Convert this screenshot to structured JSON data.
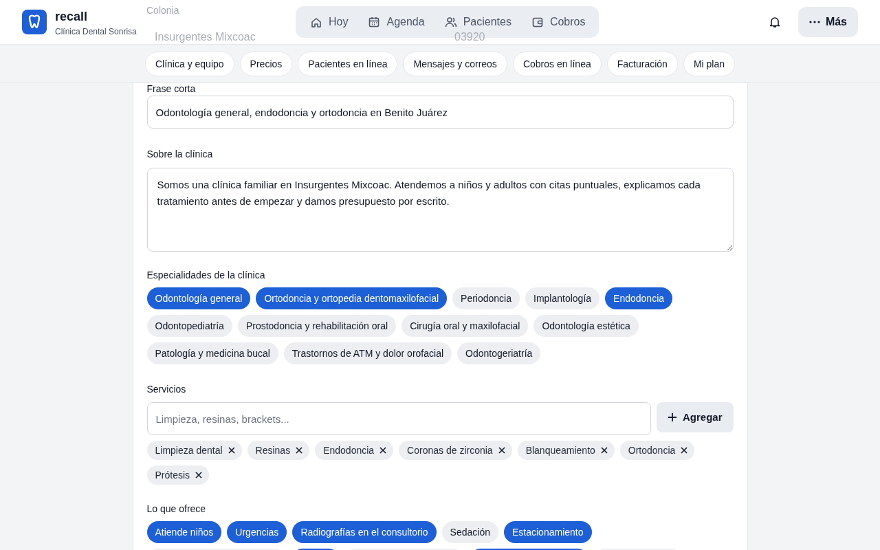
{
  "header": {
    "app_name": "recall",
    "clinic_name": "Clínica Dental Sonrisa",
    "nav": [
      {
        "label": "Hoy",
        "selected": false
      },
      {
        "label": "Agenda",
        "selected": false
      },
      {
        "label": "Pacientes",
        "selected": false
      },
      {
        "label": "Cobros",
        "selected": false
      }
    ],
    "more_button": "Más"
  },
  "behind_header": {
    "label": "Colonia",
    "value_1": "Insurgentes Mixcoac",
    "value_2": "03920"
  },
  "settings_tabs": [
    {
      "label": "Clínica y equipo",
      "selected": false
    },
    {
      "label": "Precios",
      "selected": false
    },
    {
      "label": "Pacientes en línea",
      "selected": false
    },
    {
      "label": "Mensajes y correos",
      "selected": false
    },
    {
      "label": "Cobros en línea",
      "selected": false
    },
    {
      "label": "Facturación",
      "selected": false
    },
    {
      "label": "Mi plan",
      "selected": false
    }
  ],
  "short_phrase": {
    "label": "Frase corta",
    "value": "Odontología general, endodoncia y ortodoncia en Benito Juárez"
  },
  "about": {
    "label": "Sobre la clínica",
    "value": "Somos una clínica familiar en Insurgentes Mixcoac. Atendemos a niños y adultos con citas puntuales, explicamos cada tratamiento antes de empezar y damos presupuesto por escrito."
  },
  "specialties": {
    "label": "Especialidades de la clínica",
    "items": [
      {
        "label": "Odontología general",
        "selected": true
      },
      {
        "label": "Ortodoncia y ortopedia dentomaxilofacial",
        "selected": true
      },
      {
        "label": "Periodoncia",
        "selected": false
      },
      {
        "label": "Implantología",
        "selected": false
      },
      {
        "label": "Endodoncia",
        "selected": true
      },
      {
        "label": "Odontopediatría",
        "selected": false
      },
      {
        "label": "Prostodoncia y rehabilitación oral",
        "selected": false
      },
      {
        "label": "Cirugía oral y maxilofacial",
        "selected": false
      },
      {
        "label": "Odontología estética",
        "selected": false
      },
      {
        "label": "Patología y medicina bucal",
        "selected": false
      },
      {
        "label": "Trastornos de ATM y dolor orofacial",
        "selected": false
      },
      {
        "label": "Odontogeriatría",
        "selected": false
      }
    ]
  },
  "services": {
    "label": "Servicios",
    "placeholder": "Limpieza, resinas, brackets...",
    "add_button": "Agregar",
    "tags": [
      "Limpieza dental",
      "Resinas",
      "Endodoncia",
      "Coronas de zirconia",
      "Blanqueamiento",
      "Ortodoncia",
      "Prótesis"
    ]
  },
  "offers": {
    "label": "Lo que ofrece",
    "items": [
      {
        "label": "Atiende niños",
        "selected": true
      },
      {
        "label": "Urgencias",
        "selected": true
      },
      {
        "label": "Radiografías en el consultorio",
        "selected": true
      },
      {
        "label": "Sedación",
        "selected": false
      },
      {
        "label": "Estacionamiento",
        "selected": true
      },
      {
        "selected": false
      },
      {
        "selected": true
      },
      {
        "selected": false
      },
      {
        "selected": true
      },
      {
        "selected": false
      }
    ]
  }
}
